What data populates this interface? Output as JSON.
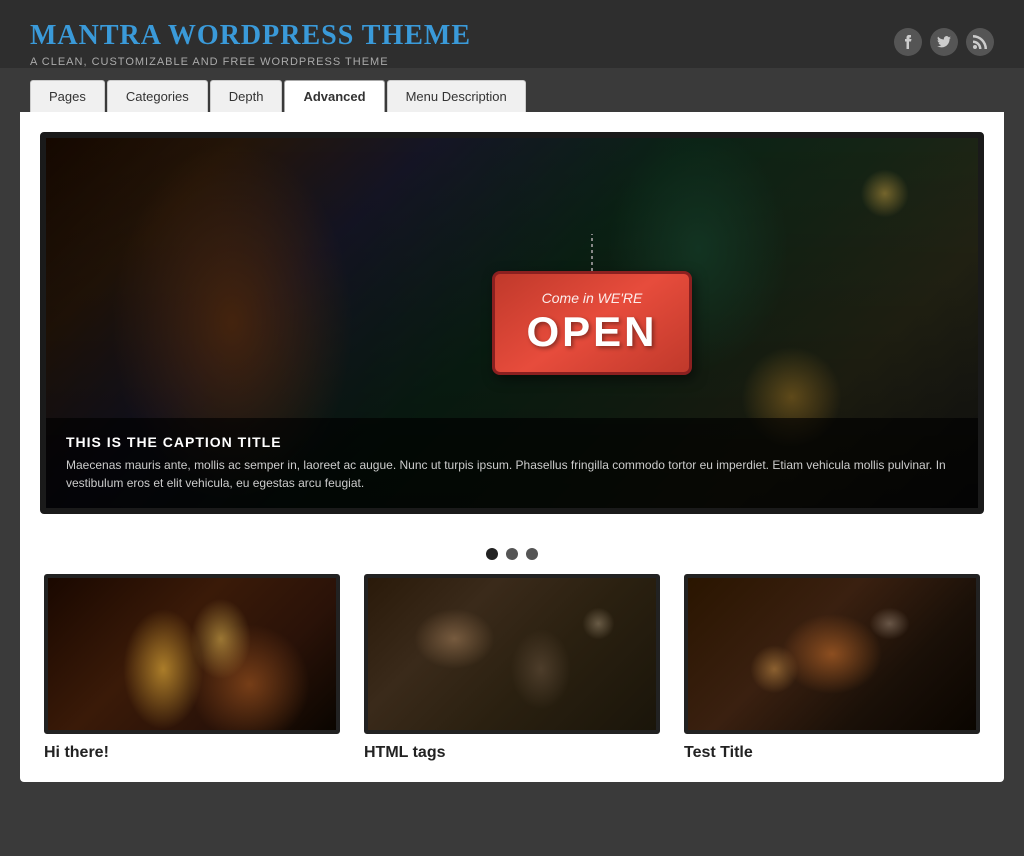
{
  "header": {
    "site_title": "Mantra WordPress Theme",
    "site_tagline": "A Clean, Customizable and Free WordPress Theme"
  },
  "social": {
    "facebook_label": "f",
    "twitter_label": "t",
    "rss_label": "rss"
  },
  "nav": {
    "tabs": [
      {
        "label": "Pages",
        "active": false
      },
      {
        "label": "Categories",
        "active": false
      },
      {
        "label": "Depth",
        "active": false
      },
      {
        "label": "Advanced",
        "active": true
      },
      {
        "label": "Menu Description",
        "active": false
      }
    ]
  },
  "slideshow": {
    "sign_top": "Come in WE'RE",
    "sign_main": "OPEN",
    "caption_title": "This Is The Caption Title",
    "caption_text": "Maecenas mauris ante, mollis ac semper in, laoreet ac augue. Nunc ut turpis ipsum. Phasellus fringilla commodo tortor eu imperdiet. Etiam vehicula mollis pulvinar. In vestibulum eros et elit vehicula, eu egestas arcu feugiat.",
    "dots": [
      {
        "active": true
      },
      {
        "active": false
      },
      {
        "active": false
      }
    ]
  },
  "cards": [
    {
      "title": "Hi there!",
      "image_type": "wine"
    },
    {
      "title": "HTML tags",
      "image_type": "cafe"
    },
    {
      "title": "Test Title",
      "image_type": "coffee"
    }
  ]
}
